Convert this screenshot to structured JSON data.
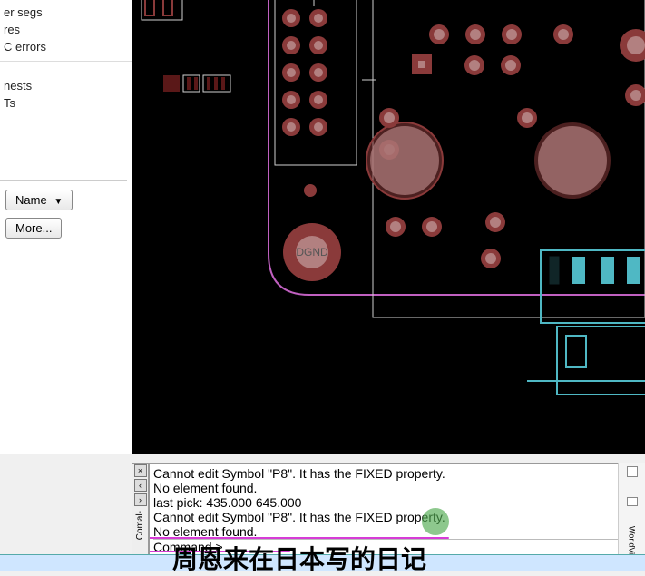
{
  "sidebar": {
    "items": [
      "er segs",
      "res",
      "C errors",
      "",
      "nests",
      "Ts"
    ]
  },
  "buttons": {
    "name": "Name",
    "more": "More..."
  },
  "pcb": {
    "dgnd_label": "DGND"
  },
  "console": {
    "lines": [
      "Cannot edit Symbol \"P8\". It has the FIXED property.",
      "No element found.",
      "last pick:  435.000 645.000",
      "Cannot edit Symbol \"P8\". It has the FIXED property.",
      "No element found."
    ],
    "prompt": "Command >",
    "tab_label": "Comal-"
  },
  "right_strip": {
    "label": "WorldVie"
  },
  "colors": {
    "via": "#8a3a3a",
    "via_inner": "#b28080",
    "pad_dark": "#5a1818",
    "silk": "#cfcfcf",
    "outline": "#c060c0",
    "cyan": "#4fb8c4"
  }
}
